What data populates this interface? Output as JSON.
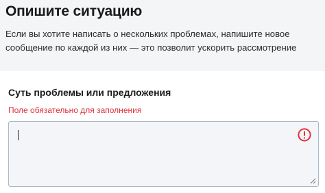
{
  "intro": {
    "title": "Опишите ситуацию",
    "text": "Если вы хотите написать о нескольких проблемах, напишите новое сообщение по каждой из них — это позволит ускорить рассмотрение"
  },
  "field": {
    "label": "Суть проблемы или предложения",
    "error": "Поле обязательно для заполнения",
    "value": "",
    "state": "error"
  },
  "icons": {
    "warning": "exclamation-circle-icon",
    "resize": "resize-grip-icon"
  },
  "colors": {
    "error": "#e0333c",
    "intro_background": "#f4f5f7",
    "field_border": "#a9b8c9"
  }
}
